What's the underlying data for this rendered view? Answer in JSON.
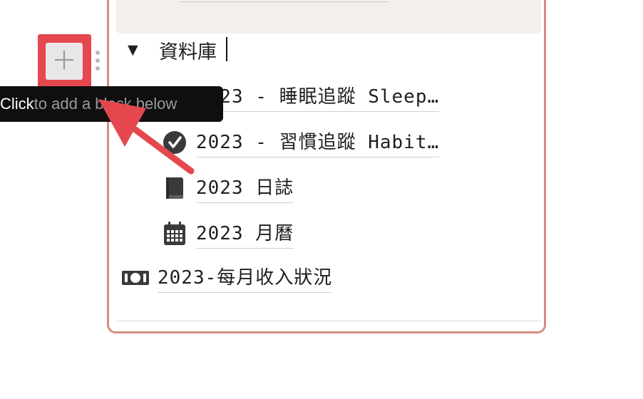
{
  "database_section": {
    "toggle_symbol": "▼",
    "heading": "資料庫",
    "items": [
      {
        "icon": "bed-icon",
        "label": "2023 - 睡眠追蹤 Sleep…"
      },
      {
        "icon": "check-circle-icon",
        "label": "2023 - 習慣追蹤 Habit…"
      },
      {
        "icon": "book-icon",
        "label": "2023 日誌"
      },
      {
        "icon": "calendar-icon",
        "label": "2023 月曆"
      }
    ],
    "money_item": {
      "icon": "money-icon",
      "label": "2023-每月收入狀況"
    }
  },
  "block_controls": {
    "add_icon": "plus-icon",
    "drag_icon": "drag-handle-icon",
    "tooltip_strong": "Click",
    "tooltip_rest": " to add a block below"
  },
  "annotation": {
    "highlight_color": "#e5474f",
    "arrow_color": "#e5474f"
  }
}
